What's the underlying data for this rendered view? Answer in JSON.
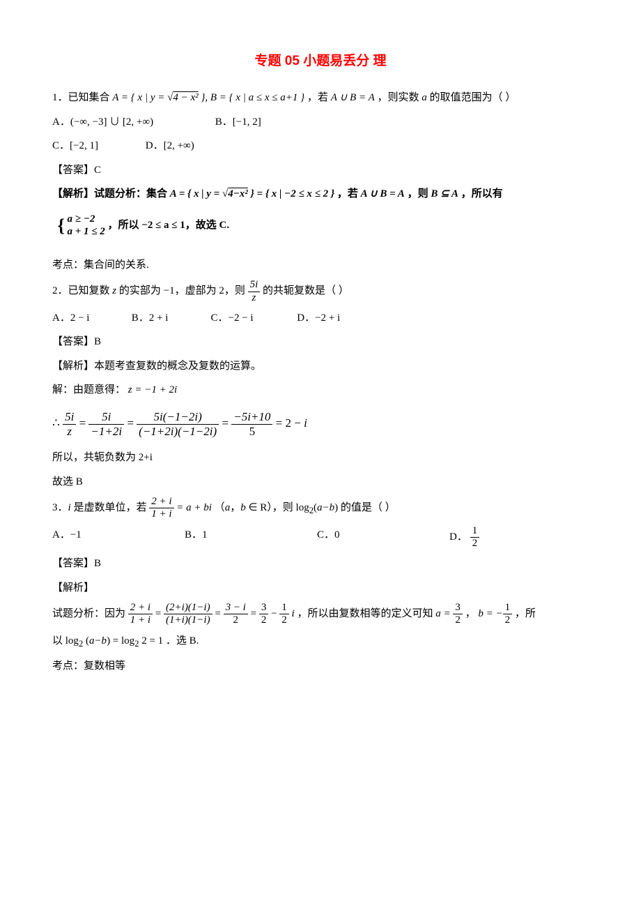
{
  "title": "专题 05 小题易丢分 理",
  "q1": {
    "stem_pre": "1．已知集合 ",
    "stem_math": "A = { x | y = √(4 − x²) }, B = { x | a ≤ x ≤ a+1 }",
    "stem_mid": "，若 ",
    "stem_math2": "A ∪ B = A",
    "stem_post": "，则实数 a 的取值范围为（  ）",
    "optA": "A．(−∞, −3] ∪ [2, +∞)",
    "optB": "B．[−1, 2]",
    "optC": "C．[−2, 1]",
    "optD": "D．[2, +∞)",
    "ans": "【答案】C",
    "analysis_label": "【解析】试题分析：集合 ",
    "analysis_math": "A = { x | y = √(4−x²) } = { x | −2 ≤ x ≤ 2 }",
    "analysis_mid": "，若 ",
    "analysis_math2": "A ∪ B = A",
    "analysis_mid2": "，则 ",
    "analysis_math3": "B ⊆ A",
    "analysis_post": "，所以有",
    "brace_top": "a ≥ −2",
    "brace_bot": "a + 1 ≤ 2",
    "brace_post": "，所以 −2 ≤ a ≤ 1，故选 C.",
    "kaodian": "考点：集合间的关系."
  },
  "q2": {
    "stem_pre": "2．已知复数 z 的实部为 −1，虚部为 2，则 ",
    "stem_post": " 的共轭复数是（    ）",
    "frac_num": "5i",
    "frac_den": "z",
    "optA": "A．2 − i",
    "optB": "B．2 + i",
    "optC": "C．−2 − i",
    "optD": "D．−2 + i",
    "ans": "【答案】B",
    "analysis": "【解析】本题考查复数的概念及复数的运算。",
    "step1_pre": "解：由题意得：",
    "step1_math": "z = −1 + 2i",
    "eq": "∴ 5i / z = 5i / (−1+2i) = 5i(−1−2i) / ((−1+2i)(−1−2i)) = (−5i+10)/5 = 2 − i",
    "conj": "所以，共轭负数为 2+i",
    "choose": "故选 B"
  },
  "q3": {
    "stem_pre": "3．i 是虚数单位，若 ",
    "stem_mid": " = a + bi （a，b ∈ R），则 log₂(a−b) 的值是（   ）",
    "frac_num": "2 + i",
    "frac_den": "1 + i",
    "optA": "A．−1",
    "optB": "B．1",
    "optC": "C．0",
    "optD_pre": "D．",
    "optD_num": "1",
    "optD_den": "2",
    "ans": "【答案】B",
    "analysis_label": "【解析】",
    "line1_pre": "试题分析：因为 ",
    "line1_mid": "，所以由复数相等的定义可知 ",
    "line1_a": "a = 3/2",
    "line1_b": "b = −1/2",
    "line1_post": "，所",
    "eq_lhs_num": "2 + i",
    "eq_lhs_den": "1 + i",
    "eq_m1_num": "(2+i)(1−i)",
    "eq_m1_den": "(1+i)(1−i)",
    "eq_m2_num": "3 − i",
    "eq_m2_den": "2",
    "eq_rhs": "3/2 − (1/2) i",
    "line2_pre": "以 ",
    "line2_math": "log₂(a−b) = log₂ 2 = 1",
    "line2_post": "．选 B.",
    "kaodian": "考点：复数相等"
  }
}
